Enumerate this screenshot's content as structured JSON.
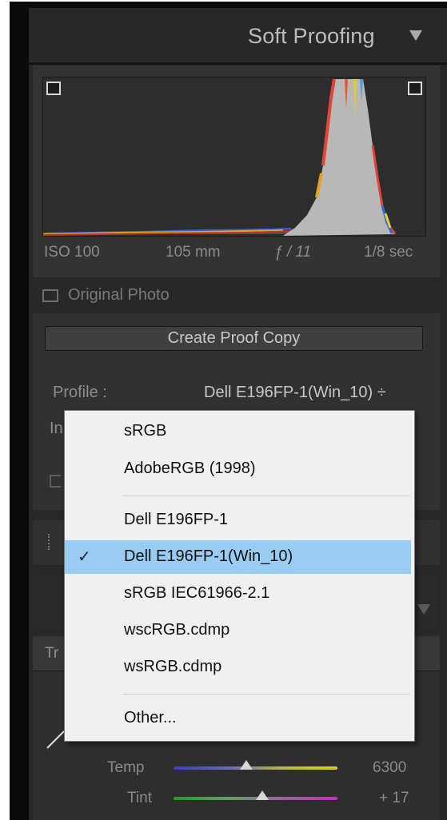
{
  "colors": {
    "panel_bg": "#282828",
    "menu_bg": "#f0f0f0",
    "menu_selected": "#99ccf3",
    "histogram_fill": "#b8b8b8"
  },
  "header": {
    "title": "Soft Proofing",
    "collapse_icon": "triangle-down-icon"
  },
  "histogram": {
    "top_left_icon": "monitor-gamut-warning-icon",
    "top_right_icon": "destination-gamut-warning-icon",
    "exif": {
      "iso": "ISO 100",
      "focal": "105 mm",
      "aperture": "ƒ / 11",
      "shutter": "1/8 sec"
    }
  },
  "original_photo": {
    "label": "Original Photo",
    "checked": false
  },
  "proof": {
    "create_button": "Create Proof Copy",
    "profile_label": "Profile :",
    "profile_value": "Dell E196FP-1(Win_10) ÷",
    "intent_fragment": "In"
  },
  "white_balance": {
    "tab_fragment": "Tr",
    "sliders": [
      {
        "label": "Temp",
        "value": "6300",
        "position": 0.48
      },
      {
        "label": "Tint",
        "value": "+ 17",
        "position": 0.55
      }
    ]
  },
  "profile_menu": {
    "groups": [
      [
        {
          "label": "sRGB",
          "selected": false
        },
        {
          "label": "AdobeRGB (1998)",
          "selected": false
        }
      ],
      [
        {
          "label": "Dell E196FP-1",
          "selected": false
        },
        {
          "label": "Dell E196FP-1(Win_10)",
          "selected": true
        },
        {
          "label": "sRGB IEC61966-2.1",
          "selected": false
        },
        {
          "label": "wscRGB.cdmp",
          "selected": false
        },
        {
          "label": "wsRGB.cdmp",
          "selected": false
        }
      ],
      [
        {
          "label": "Other...",
          "selected": false
        }
      ]
    ]
  }
}
